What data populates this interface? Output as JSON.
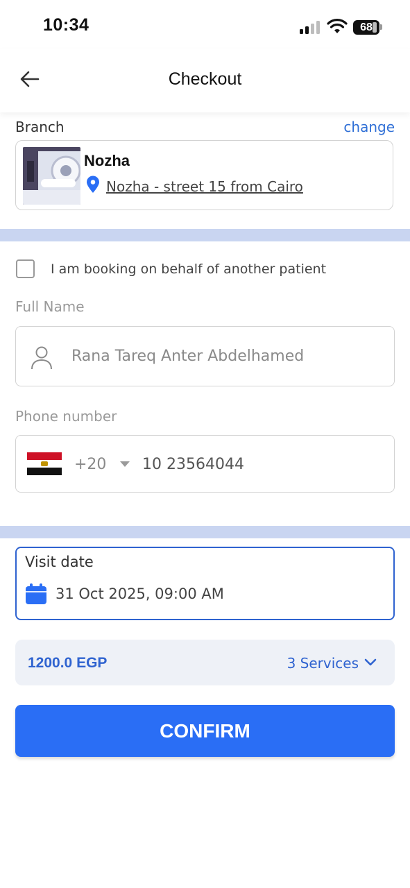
{
  "status_bar": {
    "time": "10:34",
    "battery": "68"
  },
  "header": {
    "title": "Checkout",
    "back_icon": "arrow-left-icon"
  },
  "branch": {
    "label": "Branch",
    "change_label": "change",
    "name": "Nozha",
    "address": "Nozha - street 15 from Cairo",
    "pin_color": "#2a6ef5"
  },
  "booking": {
    "behalf_label": "I am booking on behalf of another patient",
    "behalf_checked": false
  },
  "full_name": {
    "label": "Full Name",
    "value": "Rana Tareq Anter Abdelhamed",
    "icon": "person-icon"
  },
  "phone": {
    "label": "Phone number",
    "country_code": "+20",
    "number": "10 23564044",
    "flag": "egypt-flag-icon"
  },
  "visit": {
    "label": "Visit date",
    "value": "31 Oct 2025, 09:00 AM",
    "icon": "calendar-icon"
  },
  "summary": {
    "price": "1200.0 EGP",
    "services": "3 Services"
  },
  "confirm": {
    "label": "CONFIRM"
  },
  "colors": {
    "accent": "#2a6ef5",
    "divider": "#c9d5f1",
    "summary_bg": "#eef1f7"
  }
}
